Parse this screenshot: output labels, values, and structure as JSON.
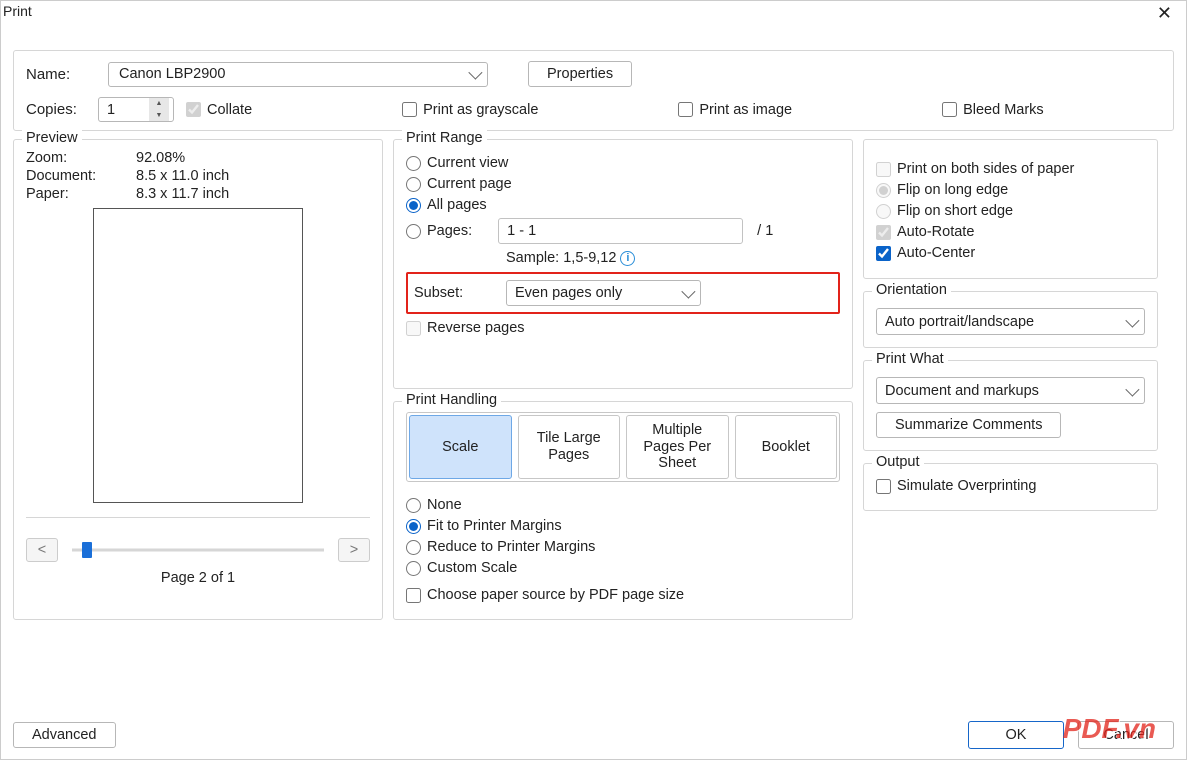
{
  "window": {
    "title": "Print"
  },
  "top": {
    "name_label": "Name:",
    "printer": "Canon LBP2900",
    "properties": "Properties",
    "copies_label": "Copies:",
    "copies_value": "1",
    "collate": "Collate",
    "grayscale": "Print as grayscale",
    "as_image": "Print as image",
    "bleed": "Bleed Marks"
  },
  "preview": {
    "legend": "Preview",
    "zoom_k": "Zoom:",
    "zoom_v": "92.08%",
    "doc_k": "Document:",
    "doc_v": "8.5 x 11.0 inch",
    "paper_k": "Paper:",
    "paper_v": "8.3 x 11.7 inch",
    "prev": "<",
    "next": ">",
    "page_label": "Page 2 of 1"
  },
  "range": {
    "legend": "Print Range",
    "current_view": "Current view",
    "current_page": "Current page",
    "all_pages": "All pages",
    "pages_label": "Pages:",
    "pages_value": "1 - 1",
    "pages_total": "/ 1",
    "sample": "Sample: 1,5-9,12",
    "subset_label": "Subset:",
    "subset_value": "Even pages only",
    "reverse": "Reverse pages"
  },
  "handling": {
    "legend": "Print Handling",
    "tabs": {
      "scale": "Scale",
      "tile": "Tile Large Pages",
      "multi": "Multiple Pages Per Sheet",
      "booklet": "Booklet"
    },
    "none": "None",
    "fit": "Fit to Printer Margins",
    "reduce": "Reduce to Printer Margins",
    "custom": "Custom Scale",
    "choose_source": "Choose paper source by PDF page size"
  },
  "right": {
    "both_sides": "Print on both sides of paper",
    "flip_long": "Flip on long edge",
    "flip_short": "Flip on short edge",
    "auto_rotate": "Auto-Rotate",
    "auto_center": "Auto-Center",
    "orientation_legend": "Orientation",
    "orientation_value": "Auto portrait/landscape",
    "what_legend": "Print What",
    "what_value": "Document and markups",
    "summarize": "Summarize Comments",
    "output_legend": "Output",
    "simulate": "Simulate Overprinting"
  },
  "footer": {
    "advanced": "Advanced",
    "ok": "OK",
    "cancel": "Cancel"
  },
  "watermark": "PDF.vn"
}
